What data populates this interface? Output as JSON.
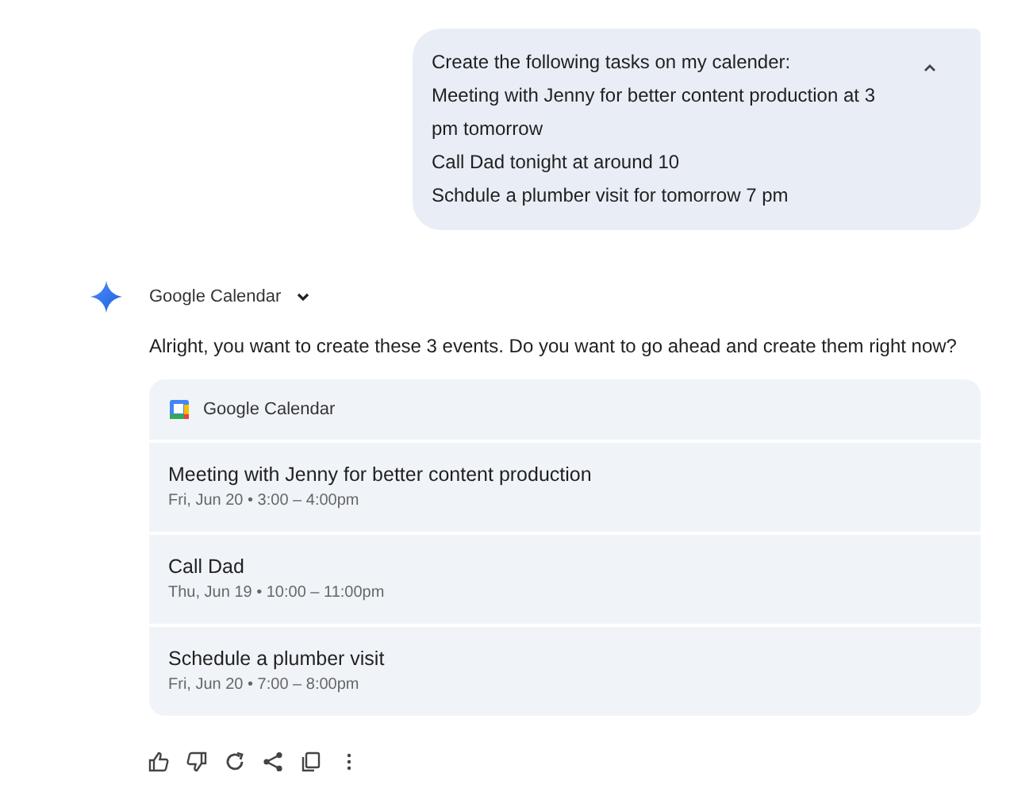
{
  "user_message": {
    "lines": [
      "Create the following tasks on my calender:",
      "Meeting with Jenny for better content production at 3",
      "pm tomorrow",
      "Call Dad tonight at around 10",
      "Schdule a plumber visit for tomorrow 7 pm"
    ],
    "expanded": true
  },
  "response": {
    "source": "Google Calendar",
    "text": "Alright, you want to create these 3 events. Do you want to go ahead and create them right now?"
  },
  "card": {
    "title": "Google Calendar",
    "events": [
      {
        "title": "Meeting with Jenny for better content production",
        "when": "Fri, Jun 20 • 3:00 – 4:00pm"
      },
      {
        "title": "Call Dad",
        "when": "Thu, Jun 19 • 10:00 – 11:00pm"
      },
      {
        "title": "Schedule a plumber visit",
        "when": "Fri, Jun 20 • 7:00 – 8:00pm"
      }
    ]
  }
}
